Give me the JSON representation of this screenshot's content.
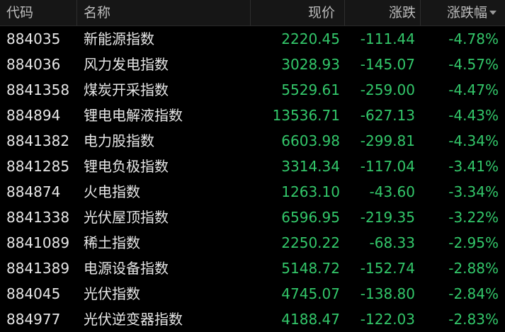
{
  "header": {
    "code": "代码",
    "name": "名称",
    "price": "现价",
    "change": "涨跌",
    "pct": "涨跌幅"
  },
  "colors": {
    "background": "#000000",
    "header_background": "#161616",
    "text": "#e6e6e6",
    "down_green": "#33c76a"
  },
  "rows": [
    {
      "code": "884035",
      "name": "新能源指数",
      "price": "2220.45",
      "change": "-111.44",
      "pct": "-4.78%"
    },
    {
      "code": "884036",
      "name": "风力发电指数",
      "price": "3028.93",
      "change": "-145.07",
      "pct": "-4.57%"
    },
    {
      "code": "8841358",
      "name": "煤炭开采指数",
      "price": "5529.61",
      "change": "-259.00",
      "pct": "-4.47%"
    },
    {
      "code": "884894",
      "name": "锂电电解液指数",
      "price": "13536.71",
      "change": "-627.13",
      "pct": "-4.43%"
    },
    {
      "code": "8841382",
      "name": "电力股指数",
      "price": "6603.98",
      "change": "-299.81",
      "pct": "-4.34%"
    },
    {
      "code": "8841285",
      "name": "锂电负极指数",
      "price": "3314.34",
      "change": "-117.04",
      "pct": "-3.41%"
    },
    {
      "code": "884874",
      "name": "火电指数",
      "price": "1263.10",
      "change": "-43.60",
      "pct": "-3.34%"
    },
    {
      "code": "8841338",
      "name": "光伏屋顶指数",
      "price": "6596.95",
      "change": "-219.35",
      "pct": "-3.22%"
    },
    {
      "code": "8841089",
      "name": "稀土指数",
      "price": "2250.22",
      "change": "-68.33",
      "pct": "-2.95%"
    },
    {
      "code": "8841389",
      "name": "电源设备指数",
      "price": "5148.72",
      "change": "-152.74",
      "pct": "-2.88%"
    },
    {
      "code": "884045",
      "name": "光伏指数",
      "price": "4745.07",
      "change": "-138.80",
      "pct": "-2.84%"
    },
    {
      "code": "884977",
      "name": "光伏逆变器指数",
      "price": "4188.47",
      "change": "-122.03",
      "pct": "-2.83%"
    }
  ]
}
